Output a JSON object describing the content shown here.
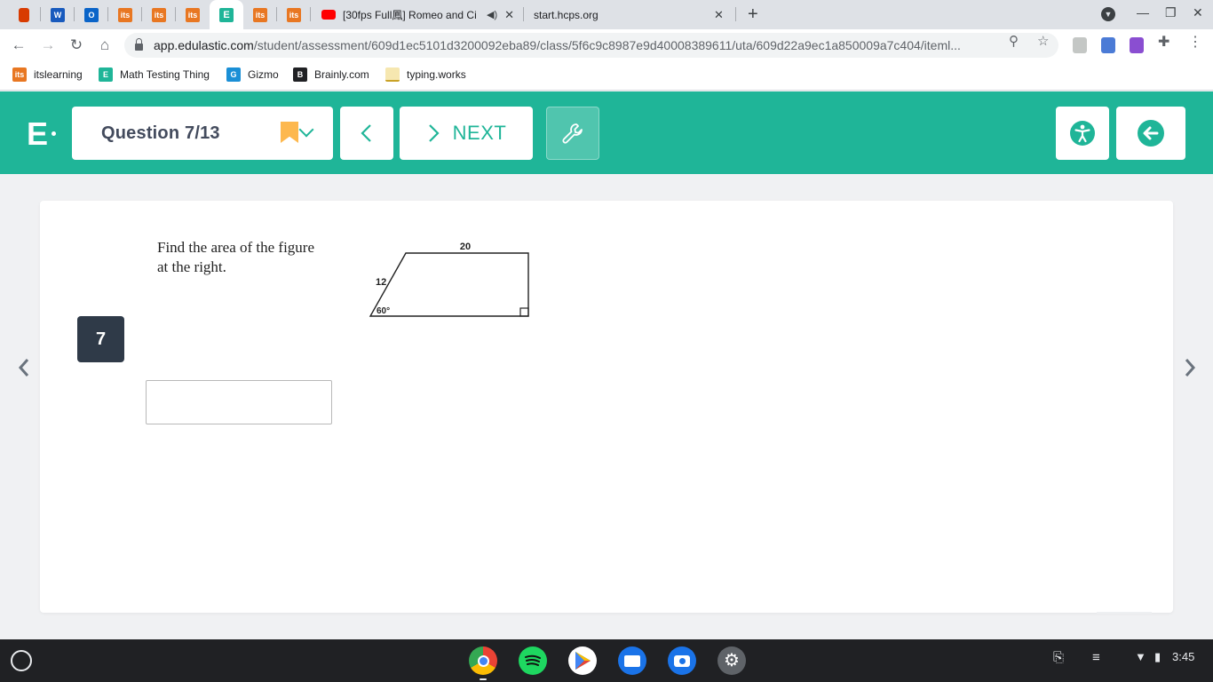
{
  "browser": {
    "tabs": [
      {
        "kind": "pinned",
        "icon": "office-icon",
        "label": ""
      },
      {
        "kind": "pinned",
        "icon": "word-icon",
        "label": "W"
      },
      {
        "kind": "pinned",
        "icon": "outlook-icon",
        "label": "O"
      },
      {
        "kind": "pinned",
        "icon": "itslearning-icon",
        "label": "its"
      },
      {
        "kind": "pinned",
        "icon": "itslearning-icon",
        "label": "its"
      },
      {
        "kind": "pinned",
        "icon": "itslearning-icon",
        "label": "its"
      },
      {
        "kind": "active",
        "icon": "edulastic-icon",
        "label": "E"
      },
      {
        "kind": "pinned",
        "icon": "itslearning-icon",
        "label": "its"
      },
      {
        "kind": "pinned",
        "icon": "itslearning-icon",
        "label": "its"
      },
      {
        "kind": "wide",
        "icon": "youtube-icon",
        "title": "[30fps Full鳳] Romeo and Ci"
      },
      {
        "kind": "wide",
        "icon": "",
        "title": "start.hcps.org"
      }
    ],
    "url_host": "app.edulastic.com",
    "url_path": "/student/assessment/609d1ec5101d3200092eba89/class/5f6c9c8987e9d40008389611/uta/609d22a9ec1a850009a7c404/iteml...",
    "bookmarks": [
      {
        "icon": "itslearning-icon",
        "icon_text": "its",
        "color": "#e87722",
        "label": "itslearning"
      },
      {
        "icon": "edulastic-icon",
        "icon_text": "E",
        "color": "#1fb598",
        "label": "Math Testing Thing"
      },
      {
        "icon": "gizmo-icon",
        "icon_text": "G",
        "color": "#1a8fd6",
        "label": "Gizmo"
      },
      {
        "icon": "brainly-icon",
        "icon_text": "B",
        "color": "#202124",
        "label": "Brainly.com"
      },
      {
        "icon": "typing-icon",
        "icon_text": "",
        "color": "#f6e7b0",
        "label": "typing.works"
      }
    ]
  },
  "edulastic": {
    "logo": "E",
    "question_label": "Question 7/13",
    "next_label": "NEXT"
  },
  "question": {
    "number": "7",
    "stem_line1": "Find the area of the figure",
    "stem_line2": "at the right.",
    "figure": {
      "top_label": "20",
      "side_label": "12",
      "angle_label": "60°"
    },
    "answer_value": ""
  },
  "shelf": {
    "apps": [
      "chrome-icon",
      "spotify-icon",
      "play-store-icon",
      "files-icon",
      "camera-icon",
      "settings-icon"
    ],
    "time": "3:45"
  },
  "colors": {
    "brand": "#1fb598",
    "question_badge": "#2f3a48",
    "bookmark_flag": "#fdb84e"
  }
}
